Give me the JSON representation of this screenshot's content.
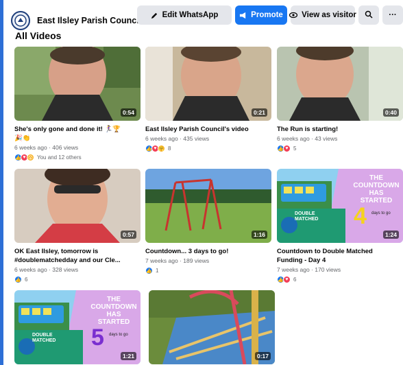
{
  "header": {
    "page_name": "East Ilsley Parish Council",
    "edit_label": "Edit WhatsApp",
    "promote_label": "Promote",
    "visitor_label": "View as visitor",
    "more_label": "···"
  },
  "section_title": "All Videos",
  "videos": [
    {
      "title": "She's only gone and done it! 🏃‍♀️🏆",
      "title2": "🎉👏",
      "meta": "6 weeks ago · 406 views",
      "duration": "0:54",
      "reactions": [
        "like",
        "love",
        "wow"
      ],
      "count": "You and 12 others"
    },
    {
      "title": "East Ilsley Parish Council's video",
      "title2": "",
      "meta": "6 weeks ago · 435 views",
      "duration": "0:21",
      "reactions": [
        "like",
        "love",
        "care"
      ],
      "count": "8"
    },
    {
      "title": "The Run is starting!",
      "title2": "",
      "meta": "6 weeks ago · 43 views",
      "duration": "0:40",
      "reactions": [
        "like",
        "love"
      ],
      "count": "5"
    },
    {
      "title": "OK East Ilsley, tomorrow is",
      "title2": "#doublematchedday and our Cle...",
      "meta": "6 weeks ago · 328 views",
      "duration": "0:57",
      "reactions": [
        "like"
      ],
      "count": "6"
    },
    {
      "title": "Countdown... 3 days to go!",
      "title2": "",
      "meta": "7 weeks ago · 189 views",
      "duration": "1:16",
      "reactions": [
        "like"
      ],
      "count": "1"
    },
    {
      "title": "Countdown to Double Matched",
      "title2": "Funding - Day 4",
      "meta": "7 weeks ago · 170 views",
      "duration": "1:24",
      "reactions": [
        "like",
        "love"
      ],
      "count": "6"
    },
    {
      "title": "",
      "title2": "",
      "meta": "",
      "duration": "1:21",
      "reactions": [],
      "count": ""
    },
    {
      "title": "",
      "title2": "",
      "meta": "",
      "duration": "0:17",
      "reactions": [],
      "count": ""
    }
  ],
  "poster": {
    "line1": "THE",
    "line2": "COUNTDOWN",
    "line3": "HAS",
    "line4": "STARTED",
    "badge1": "DOUBLE",
    "badge2": "MATCHED",
    "num_a": "4",
    "num_b": "5",
    "days": "days to go"
  },
  "colors": {
    "accent": "#1877f2",
    "frame": "#2d6fd6"
  }
}
